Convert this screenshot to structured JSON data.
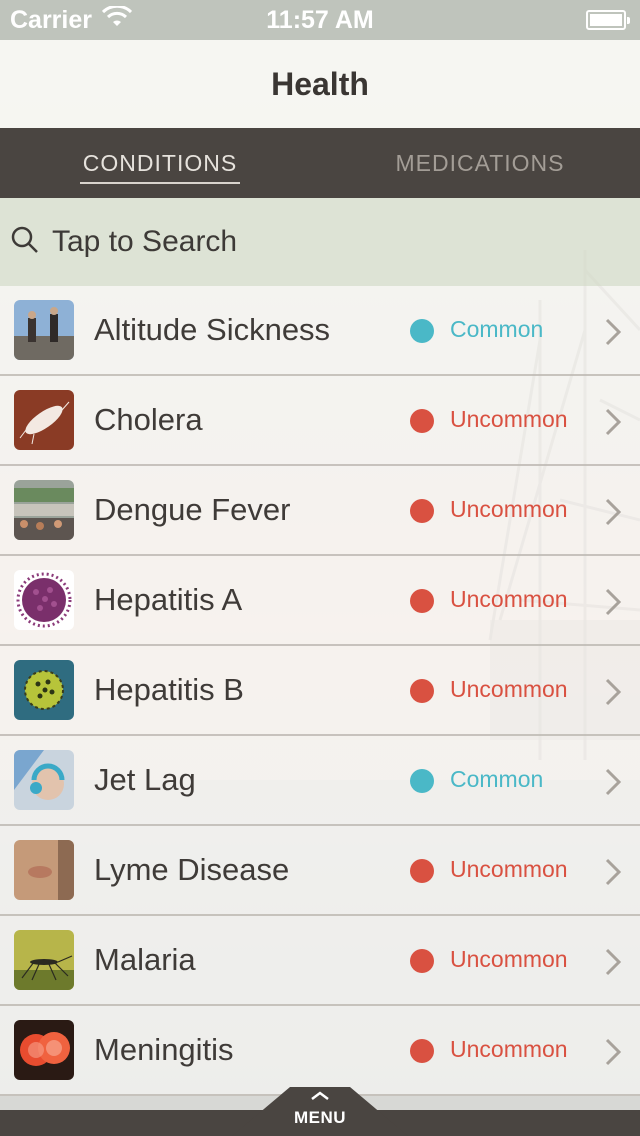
{
  "status_bar": {
    "carrier": "Carrier",
    "time": "11:57 AM"
  },
  "nav": {
    "title": "Health"
  },
  "tabs": [
    {
      "label": "CONDITIONS",
      "active": true
    },
    {
      "label": "MEDICATIONS",
      "active": false
    }
  ],
  "search": {
    "placeholder": "Tap to Search"
  },
  "colors": {
    "common": "#4ab8c7",
    "uncommon": "#d95141",
    "bar": "#4a4541"
  },
  "conditions": [
    {
      "name": "Altitude Sickness",
      "status": "Common",
      "level": "common",
      "icon": "mountain-hikers-icon"
    },
    {
      "name": "Cholera",
      "status": "Uncommon",
      "level": "uncommon",
      "icon": "bacterium-icon"
    },
    {
      "name": "Dengue Fever",
      "status": "Uncommon",
      "level": "uncommon",
      "icon": "crowd-tents-icon"
    },
    {
      "name": "Hepatitis A",
      "status": "Uncommon",
      "level": "uncommon",
      "icon": "virus-purple-icon"
    },
    {
      "name": "Hepatitis B",
      "status": "Uncommon",
      "level": "uncommon",
      "icon": "virus-green-icon"
    },
    {
      "name": "Jet Lag",
      "status": "Common",
      "level": "common",
      "icon": "headphones-traveler-icon"
    },
    {
      "name": "Lyme Disease",
      "status": "Uncommon",
      "level": "uncommon",
      "icon": "skin-rash-icon"
    },
    {
      "name": "Malaria",
      "status": "Uncommon",
      "level": "uncommon",
      "icon": "mosquito-icon"
    },
    {
      "name": "Meningitis",
      "status": "Uncommon",
      "level": "uncommon",
      "icon": "bacteria-red-icon"
    }
  ],
  "menu": {
    "label": "MENU"
  }
}
